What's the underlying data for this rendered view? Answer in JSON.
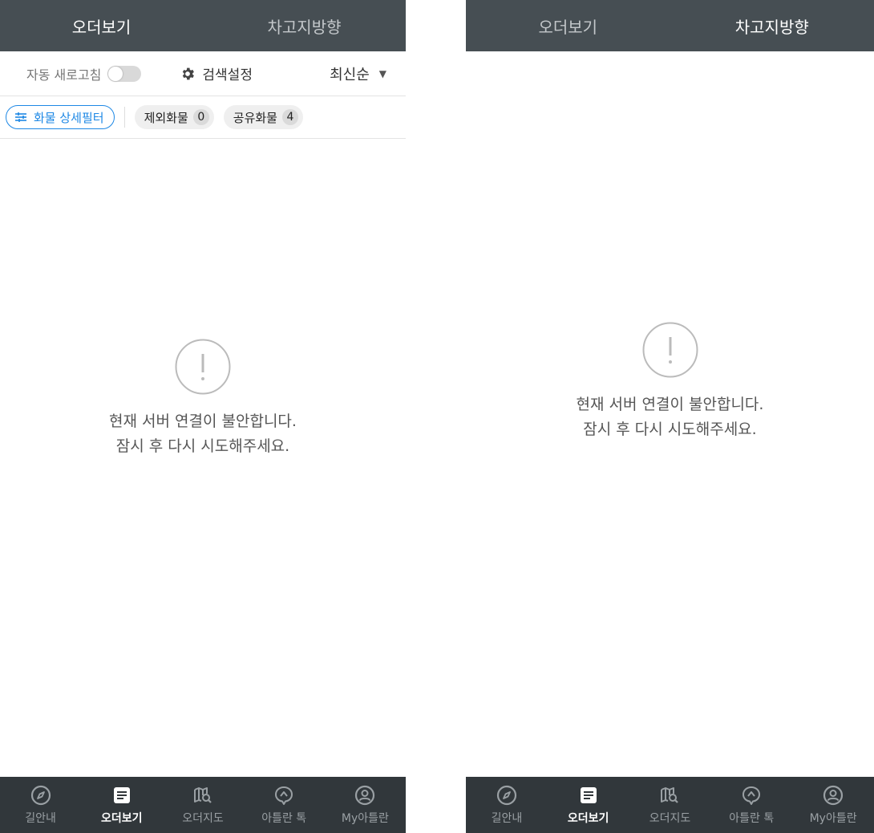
{
  "tabs": [
    {
      "label": "오더보기"
    },
    {
      "label": "차고지방향"
    }
  ],
  "toolbar": {
    "auto_refresh_label": "자동 새로고침",
    "search_settings_label": "검색설정",
    "sort_label": "최신순"
  },
  "filters": {
    "detail_filter_label": "화물 상세필터",
    "excluded_label": "제외화물",
    "excluded_count": "0",
    "shared_label": "공유화물",
    "shared_count": "4"
  },
  "error": {
    "line1": "현재 서버 연결이 불안합니다.",
    "line2": "잠시 후 다시 시도해주세요."
  },
  "bottom_nav": [
    {
      "label": "길안내",
      "icon": "compass-icon"
    },
    {
      "label": "오더보기",
      "icon": "order-list-icon"
    },
    {
      "label": "오더지도",
      "icon": "map-search-icon"
    },
    {
      "label": "아틀란 톡",
      "icon": "chat-bubble-icon"
    },
    {
      "label": "My아틀란",
      "icon": "profile-icon"
    }
  ],
  "colors": {
    "topbar": "#464e53",
    "bottom_nav": "#31373b",
    "accent": "#1e88e5"
  }
}
